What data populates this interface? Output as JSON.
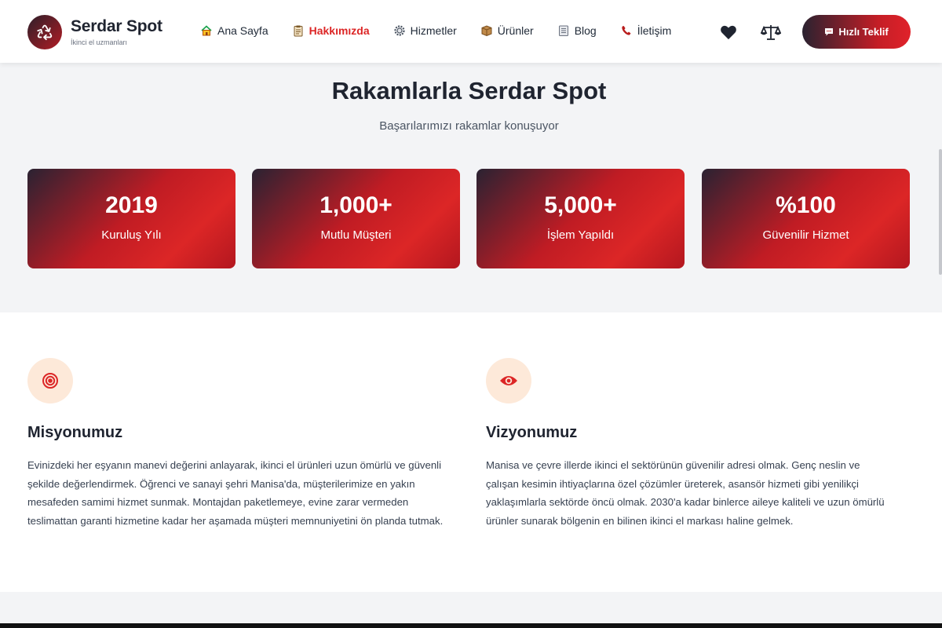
{
  "header": {
    "brand": "Serdar Spot",
    "tagline": "İkinci el uzmanları",
    "nav": [
      {
        "label": "Ana Sayfa",
        "icon": "home-icon"
      },
      {
        "label": "Hakkımızda",
        "icon": "clipboard-icon",
        "active": true
      },
      {
        "label": "Hizmetler",
        "icon": "gear-icon"
      },
      {
        "label": "Ürünler",
        "icon": "box-icon"
      },
      {
        "label": "Blog",
        "icon": "notebook-icon"
      },
      {
        "label": "İletişim",
        "icon": "phone-icon"
      }
    ],
    "quote_label": "Hızlı Teklif"
  },
  "stats": {
    "title": "Rakamlarla Serdar Spot",
    "subtitle": "Başarılarımızı rakamlar konuşuyor",
    "items": [
      {
        "value": "2019",
        "label": "Kuruluş Yılı"
      },
      {
        "value": "1,000+",
        "label": "Mutlu Müşteri"
      },
      {
        "value": "5,000+",
        "label": "İşlem Yapıldı"
      },
      {
        "value": "%100",
        "label": "Güvenilir Hizmet"
      }
    ]
  },
  "mission": {
    "title": "Misyonumuz",
    "icon": "target-icon",
    "text": "Evinizdeki her eşyanın manevi değerini anlayarak, ikinci el ürünleri uzun ömürlü ve güvenli şekilde değerlendirmek. Öğrenci ve sanayi şehri Manisa'da, müşterilerimize en yakın mesafeden samimi hizmet sunmak. Montajdan paketlemeye, evine zarar vermeden teslimattan garanti hizmetine kadar her aşamada müşteri memnuniyetini ön planda tutmak."
  },
  "vision": {
    "title": "Vizyonumuz",
    "icon": "eye-icon",
    "text": "Manisa ve çevre illerde ikinci el sektörünün güvenilir adresi olmak. Genç neslin ve çalışan kesimin ihtiyaçlarına özel çözümler üreterek, asansör hizmeti gibi yenilikçi yaklaşımlarla sektörde öncü olmak. 2030'a kadar binlerce aileye kaliteli ve uzun ömürlü ürünler sunarak bölgenin en bilinen ikinci el markası haline gelmek."
  },
  "colors": {
    "accent": "#dc2626",
    "dark": "#2a2232",
    "icon_bg": "#fde9d9"
  }
}
